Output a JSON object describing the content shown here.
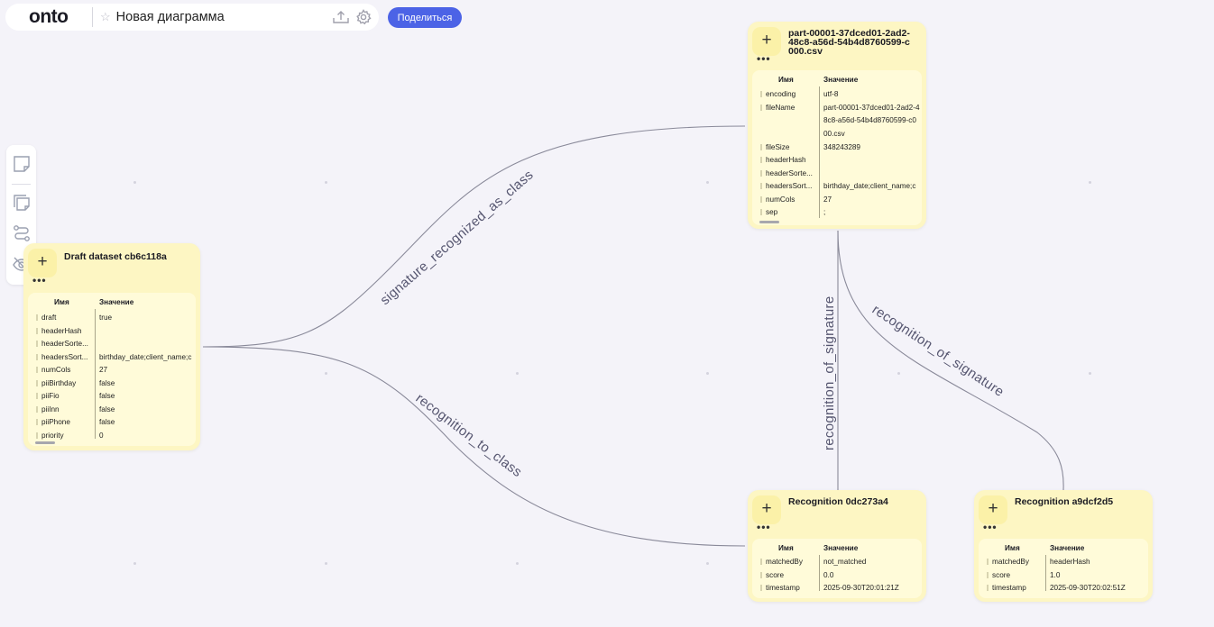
{
  "header": {
    "logo": "onto",
    "title": "Новая диаграмма",
    "share_label": "Поделиться"
  },
  "colors": {
    "accent": "#4c63e6",
    "node_bg": "#fdf6c3",
    "canvas_bg": "#f4f3f9",
    "edge": "#8a8a9a"
  },
  "toolbar": {
    "icons": [
      "note-icon",
      "notes-icon",
      "connector-icon",
      "hide-icon"
    ]
  },
  "columns": {
    "name": "Имя",
    "value": "Значение"
  },
  "nodes": [
    {
      "id": "draft",
      "title": "Draft dataset cb6c118a",
      "properties": [
        {
          "k": "draft",
          "v": "true"
        },
        {
          "k": "headerHash",
          "v": ""
        },
        {
          "k": "headerSorte...",
          "v": ""
        },
        {
          "k": "headersSort...",
          "v": "birthday_date;client_name;c"
        },
        {
          "k": "numCols",
          "v": "27"
        },
        {
          "k": "piiBirthday",
          "v": "false"
        },
        {
          "k": "piiFio",
          "v": "false"
        },
        {
          "k": "piiInn",
          "v": "false"
        },
        {
          "k": "piiPhone",
          "v": "false"
        },
        {
          "k": "priority",
          "v": "0"
        }
      ]
    },
    {
      "id": "file",
      "title": "part-00001-37dced01-2ad2-48c8-a56d-54b4d8760599-c000.csv",
      "properties": [
        {
          "k": "encoding",
          "v": "utf-8"
        },
        {
          "k": "fileName",
          "v": "part-00001-37dced01-2ad2-48c8-a56d-54b4d8760599-c000.csv"
        },
        {
          "k": "fileSize",
          "v": "348243289"
        },
        {
          "k": "headerHash",
          "v": ""
        },
        {
          "k": "headerSorte...",
          "v": ""
        },
        {
          "k": "headersSort...",
          "v": "birthday_date;client_name;c"
        },
        {
          "k": "numCols",
          "v": "27"
        },
        {
          "k": "sep",
          "v": ";"
        }
      ]
    },
    {
      "id": "rec1",
      "title": "Recognition 0dc273a4",
      "properties": [
        {
          "k": "matchedBy",
          "v": "not_matched"
        },
        {
          "k": "score",
          "v": "0.0"
        },
        {
          "k": "timestamp",
          "v": "2025-09-30T20:01:21Z"
        }
      ]
    },
    {
      "id": "rec2",
      "title": "Recognition a9dcf2d5",
      "properties": [
        {
          "k": "matchedBy",
          "v": "headerHash"
        },
        {
          "k": "score",
          "v": "1.0"
        },
        {
          "k": "timestamp",
          "v": "2025-09-30T20:02:51Z"
        }
      ]
    }
  ],
  "edges": [
    {
      "from": "draft",
      "to": "file",
      "label": "signature_recognized_as_class"
    },
    {
      "from": "draft",
      "to": "rec1",
      "label": "recognition_to_class"
    },
    {
      "from": "file",
      "to": "rec1",
      "label": "recognition_of_signature"
    },
    {
      "from": "file",
      "to": "rec2",
      "label": "recognition_of_signature"
    }
  ]
}
